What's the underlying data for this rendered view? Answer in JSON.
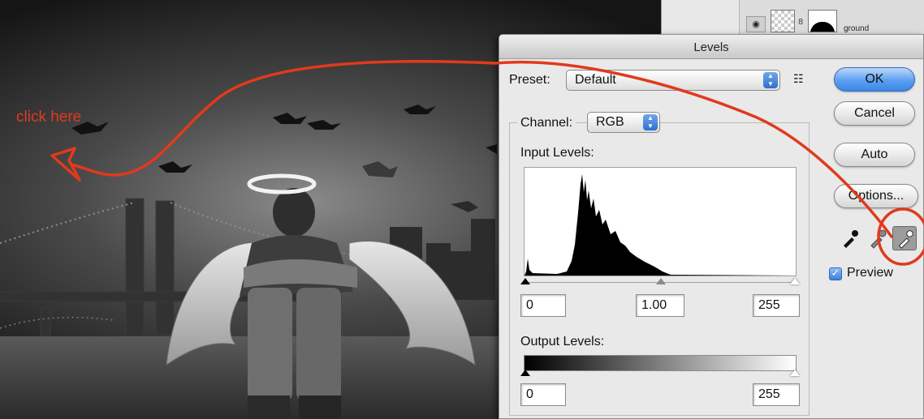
{
  "layers_panel": {
    "layer_name": "ground"
  },
  "dialog": {
    "title": "Levels",
    "preset_label": "Preset:",
    "preset_value": "Default",
    "preset_menu_glyph": "☷",
    "channel_label": "Channel:",
    "channel_value": "RGB",
    "input_levels_label": "Input Levels:",
    "input_black": "0",
    "input_gamma": "1.00",
    "input_white": "255",
    "output_levels_label": "Output Levels:",
    "output_black": "0",
    "output_white": "255",
    "buttons": {
      "ok": "OK",
      "cancel": "Cancel",
      "auto": "Auto",
      "options": "Options..."
    },
    "preview_label": "Preview",
    "preview_checked": true
  },
  "annotation": {
    "text": "click here",
    "color": "#e03a1c"
  },
  "colors": {
    "dialog_bg": "#e9e9e9",
    "default_button": "#5b9ff0",
    "annotation_red": "#e03a1c"
  },
  "icons": {
    "layer_visibility": "eye-icon",
    "black_point": "black-eyedropper-icon",
    "gray_point": "gray-eyedropper-icon",
    "white_point": "white-eyedropper-icon"
  }
}
